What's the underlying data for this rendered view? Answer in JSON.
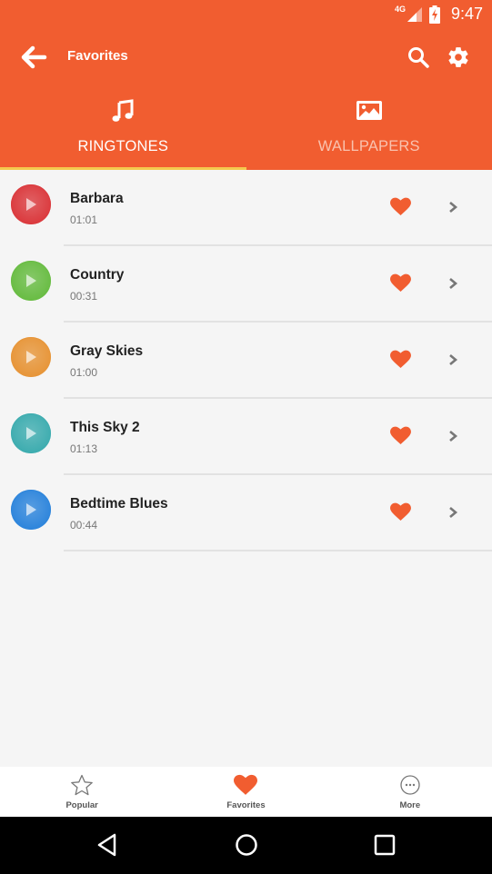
{
  "status_bar": {
    "network": "4G",
    "time": "9:47"
  },
  "app_bar": {
    "title": "Favorites",
    "icons": [
      "back-arrow-icon",
      "search-icon",
      "gear-icon"
    ]
  },
  "tabs": [
    {
      "label": "RINGTONES",
      "icon": "music-note-icon",
      "active": true
    },
    {
      "label": "WALLPAPERS",
      "icon": "image-icon",
      "active": false
    }
  ],
  "colors": {
    "primary": "#f15d30",
    "tab_indicator": "#f5c94e",
    "heart": "#f15d30"
  },
  "ringtones": [
    {
      "name": "Barbara",
      "duration": "01:01",
      "color": "#db3b3f",
      "favorite": true
    },
    {
      "name": "Country",
      "duration": "00:31",
      "color": "#6abd45",
      "favorite": true
    },
    {
      "name": "Gray Skies",
      "duration": "01:00",
      "color": "#e7963a",
      "favorite": true
    },
    {
      "name": "This Sky 2",
      "duration": "01:13",
      "color": "#3fadb0",
      "favorite": true
    },
    {
      "name": "Bedtime Blues",
      "duration": "00:44",
      "color": "#2f86dc",
      "favorite": true
    }
  ],
  "bottom_nav": [
    {
      "label": "Popular",
      "icon": "star-icon",
      "active": false
    },
    {
      "label": "Favorites",
      "icon": "heart-icon",
      "active": true
    },
    {
      "label": "More",
      "icon": "more-icon",
      "active": false
    }
  ],
  "system_nav": [
    "back",
    "home",
    "recents"
  ]
}
